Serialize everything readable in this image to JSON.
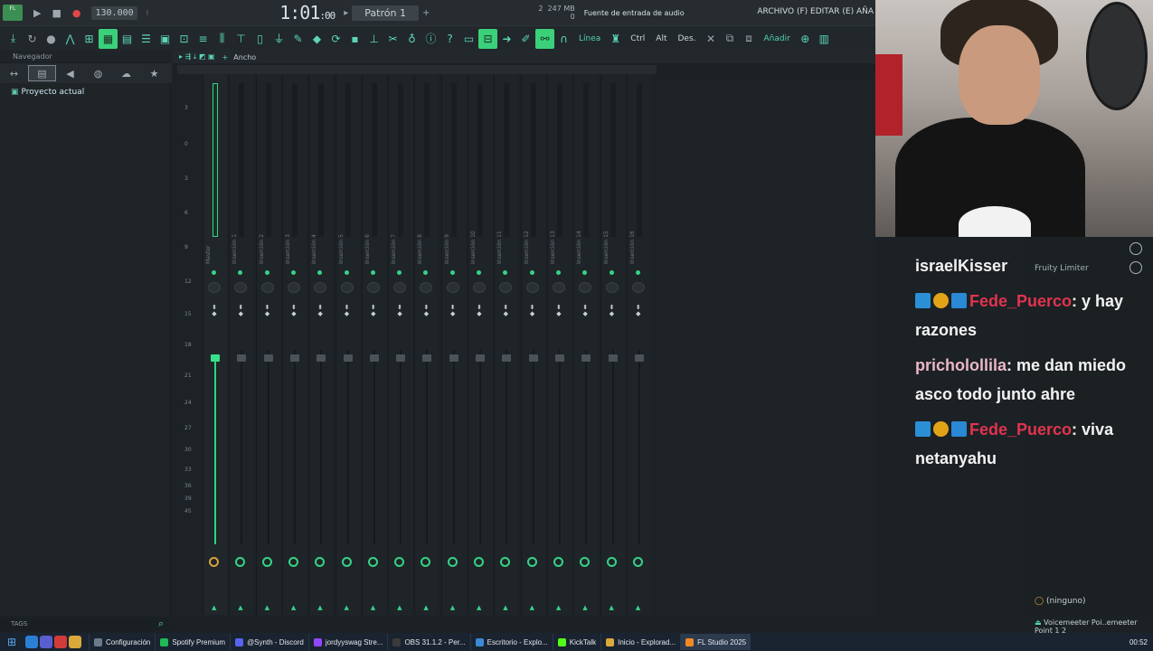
{
  "toolbar": {
    "logo_text": "FL",
    "tempo": "130.000",
    "time_main": "1:01",
    "time_sub": ":00",
    "pattern": "Patrón 1",
    "cpu_top": "247 MB",
    "cpu_val": "2",
    "cpu_bottom": "0",
    "audio_source": "Fuente de entrada de audio",
    "menu": "ARCHIVO (F) EDITAR (E) AÑA",
    "linea": "Línea",
    "ctrl": "Ctrl",
    "alt": "Alt",
    "des": "Des.",
    "anadir": "Añadir"
  },
  "browser": {
    "title": "Navegador",
    "project_label": "Proyecto actual",
    "tags_label": "TAGS"
  },
  "mixer": {
    "header_label": "Ancho",
    "scale": [
      "3",
      "0",
      "3",
      "6",
      "9",
      "12",
      "15",
      "18",
      "21",
      "24",
      "27",
      "30",
      "33",
      "36",
      "39",
      "45"
    ],
    "tracks": [
      "Master",
      "Inserción 1",
      "Inserción 2",
      "Inserción 3",
      "Inserción 4",
      "Inserción 5",
      "Inserción 6",
      "Inserción 7",
      "Inserción 8",
      "Inserción 9",
      "Inserción 10",
      "Inserción 11",
      "Inserción 12",
      "Inserción 13",
      "Inserción 14",
      "Inserción 15",
      "Inserción 16"
    ]
  },
  "chat": {
    "line0_user": "israelKisser",
    "msg1_user": "Fede_Puerco",
    "msg1_text": ": y hay razones",
    "msg2_user": "pricholollila",
    "msg2_text": ": me dan miedo asco todo junto ahre",
    "msg3_user": "Fede_Puerco",
    "msg3_text": ": viva netanyahu"
  },
  "effects": {
    "slot1": "Fruity Limiter",
    "slot_none": "(ninguno)",
    "output": "Voicemeeter Poi..emeeter Point 1 2"
  },
  "taskbar": {
    "items": [
      "Configuración",
      "Spotify Premium",
      "@Synth - Discord",
      "jordyyswag Stre...",
      "OBS 31.1.2 - Per...",
      "Escritorio - Explo...",
      "KickTalk",
      "Inicio - Explorad...",
      "FL Studio 2025"
    ],
    "clock": "00:52"
  },
  "colors": {
    "accent": "#35d386",
    "chat_user": "#e0344f",
    "chat_user_alt": "#e9b7c5"
  }
}
